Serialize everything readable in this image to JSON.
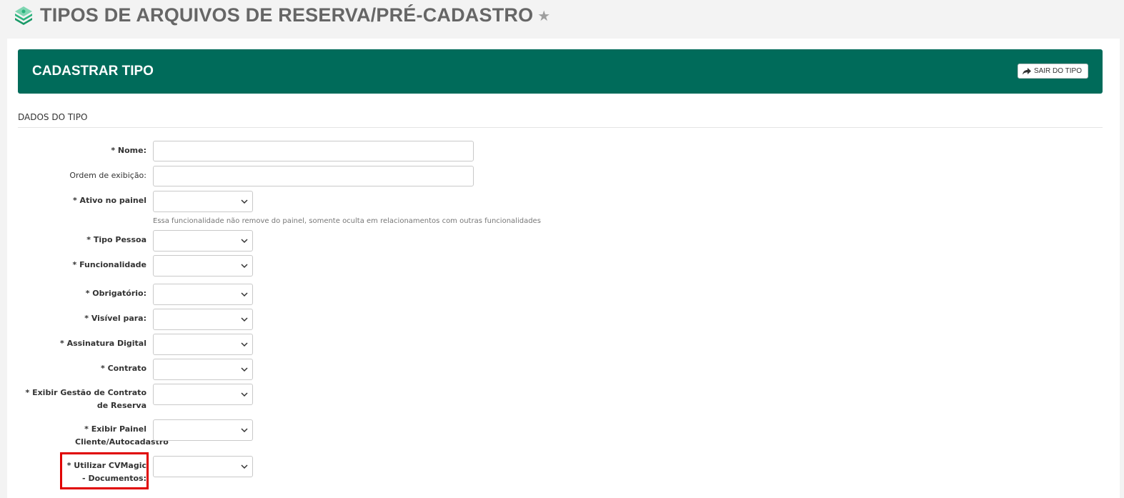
{
  "header": {
    "title": "TIPOS DE ARQUIVOS DE RESERVA/PRÉ-CADASTRO",
    "logo_icon": "money-stack-icon",
    "favorite_icon": "star-icon",
    "accent": "#00a36c"
  },
  "banner": {
    "title": "CADASTRAR TIPO",
    "exit_label": "SAIR DO TIPO",
    "exit_icon": "share-arrow-icon",
    "color": "#006b5a"
  },
  "form": {
    "section_title": "DADOS DO TIPO",
    "nome": {
      "label": "* Nome:",
      "value": ""
    },
    "ordem": {
      "label": "Ordem de exibição:",
      "value": ""
    },
    "ativo": {
      "label": "* Ativo no painel",
      "help": "Essa funcionalidade não remove do painel, somente oculta em relacionamentos com outras funcionalidades"
    },
    "tipo_pessoa": {
      "label": "* Tipo Pessoa"
    },
    "funcionalidade": {
      "label": "* Funcionalidade"
    },
    "obrigatorio": {
      "label": "* Obrigatório:"
    },
    "visivel": {
      "label": "* Visível para:"
    },
    "assinatura": {
      "label": "* Assinatura Digital"
    },
    "contrato": {
      "label": "* Contrato"
    },
    "gestao": {
      "label": "* Exibir Gestão de Contrato de Reserva"
    },
    "painel_cliente": {
      "label": "* Exibir Painel Cliente/Autocadastro"
    },
    "cvmagic": {
      "label": "* Utilizar CVMagic - Documentos:"
    }
  },
  "highlight_color": "#e00000"
}
